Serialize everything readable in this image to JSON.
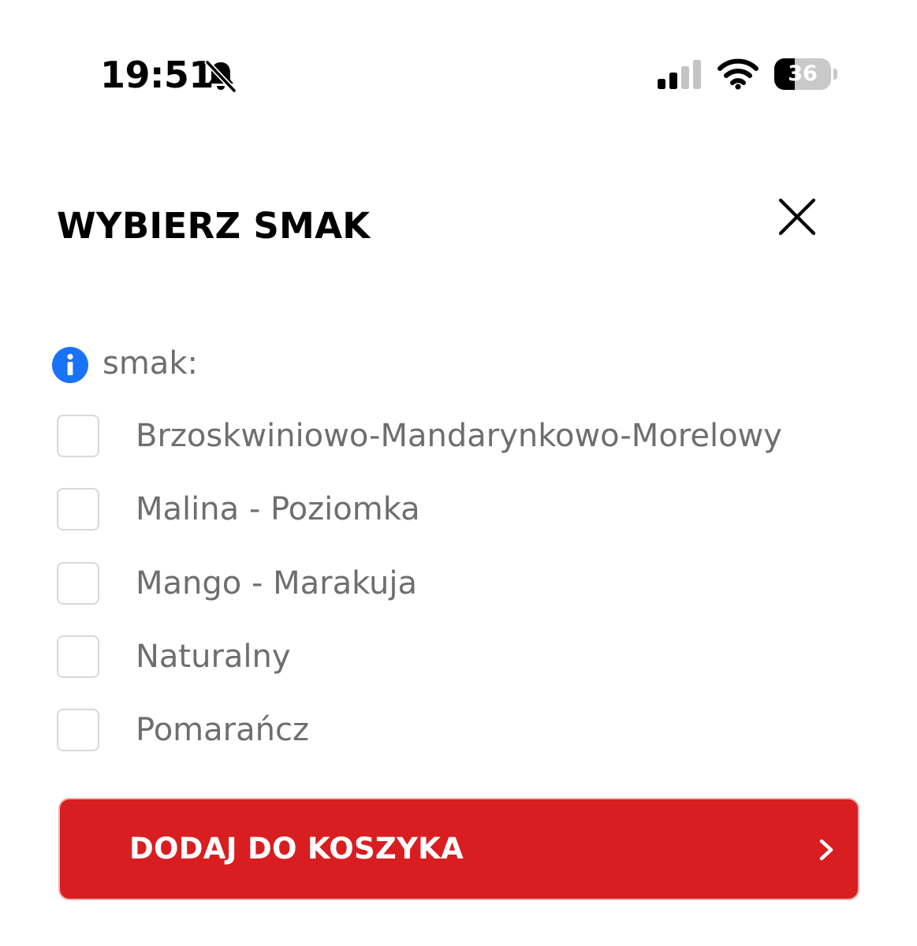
{
  "status_bar": {
    "time": "19:51",
    "battery_level": "36",
    "battery_fraction": 0.36,
    "icons": [
      "bell-slash-icon",
      "cellular-signal-icon",
      "wifi-icon",
      "battery-icon"
    ]
  },
  "modal": {
    "title": "WYBIERZ SMAK",
    "close_icon": "close-icon"
  },
  "flavor_group": {
    "info_icon": "info-icon",
    "label": "smak:",
    "options": [
      {
        "label": "Brzoskwiniowo-Mandarynkowo-Morelowy",
        "checked": false
      },
      {
        "label": "Malina - Poziomka",
        "checked": false
      },
      {
        "label": "Mango - Marakuja",
        "checked": false
      },
      {
        "label": "Naturalny",
        "checked": false
      },
      {
        "label": "Pomarańcz",
        "checked": false
      }
    ]
  },
  "cta": {
    "label": "DODAJ DO KOSZYKA",
    "icon": "chevron-right-icon"
  },
  "colors": {
    "accent_red": "#d91e22",
    "info_blue": "#1a73f5",
    "muted_text": "#6e6e6e",
    "checkbox_border": "#d9d9d9"
  }
}
